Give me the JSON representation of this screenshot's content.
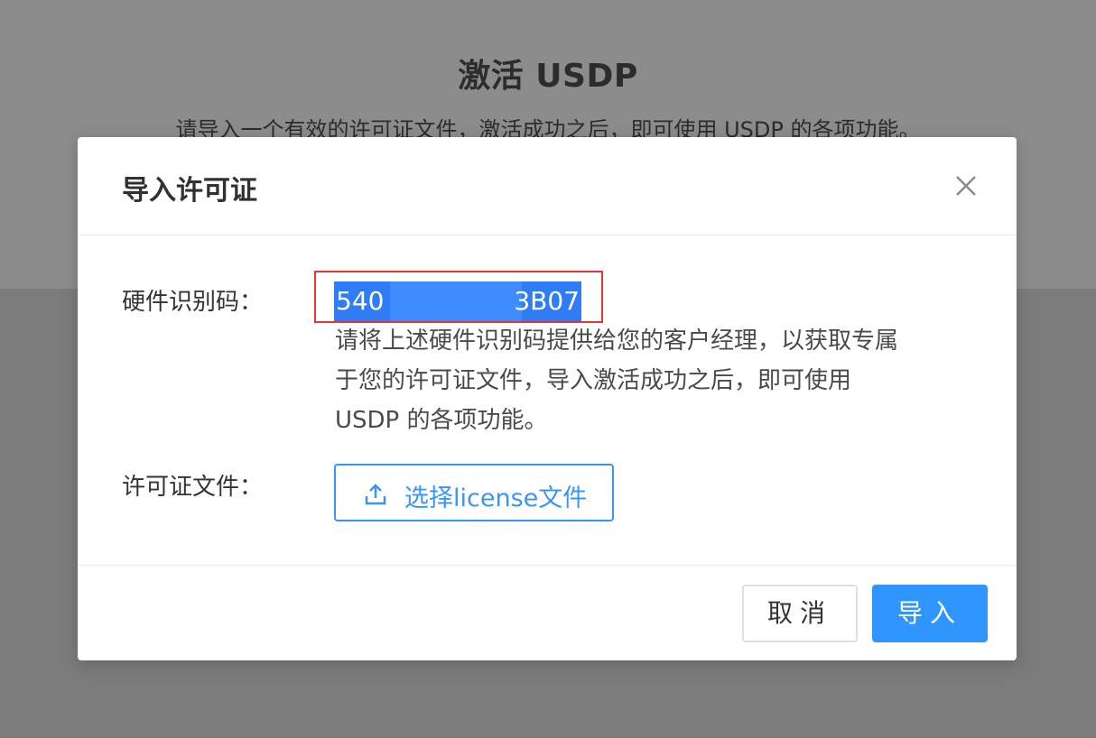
{
  "background": {
    "title": "激活 USDP",
    "description": "请导入一个有效的许可证文件，激活成功之后，即可使用 USDP 的各项功能。"
  },
  "dialog": {
    "title": "导入许可证",
    "close_icon": "close-icon",
    "hardware_id": {
      "label": "硬件识别码：",
      "value_start": "540",
      "value_end": "3B07",
      "hint": "请将上述硬件识别码提供给您的客户经理，以获取专属于您的许可证文件，导入激活成功之后，即可使用 USDP 的各项功能。"
    },
    "license_file": {
      "label": "许可证文件：",
      "upload_icon": "upload-icon",
      "button_label": "选择license文件"
    },
    "footer": {
      "cancel_label": "取消",
      "import_label": "导入"
    }
  },
  "colors": {
    "primary": "#2f95ff",
    "highlight": "#2e7cf6",
    "annotation_box": "#e53535"
  }
}
